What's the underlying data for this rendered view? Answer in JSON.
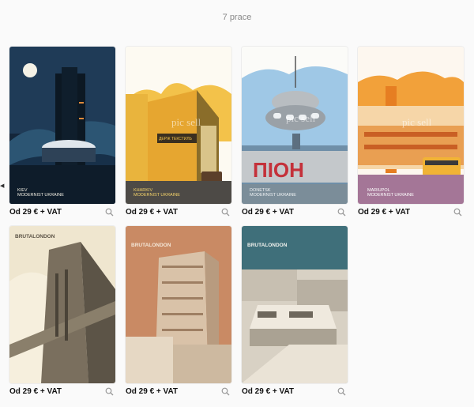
{
  "header": {
    "count_label": "7 prace"
  },
  "icons": {
    "left_arrow": "chevron-left-icon",
    "zoom": "magnifier-icon"
  },
  "colors": {
    "kiev": "#1f3b57",
    "kharkiv": "#e8b43a",
    "donetsk": "#8fbfe0",
    "mariupol": "#f2a13a",
    "bruta_sand": "#d9cfb8",
    "bruta_rust": "#c07c56",
    "bruta_teal": "#3f6f7a"
  },
  "items": [
    {
      "price": "Od 29 € + VAT",
      "caption": [
        "KIEV",
        "MODERNIST UKRAINE"
      ]
    },
    {
      "price": "Od 29 € + VAT",
      "caption": [
        "KHARKIV",
        "MODERNIST UKRAINE"
      ],
      "sign": "ДЕРЖ ТЕКСТИЛЬ"
    },
    {
      "price": "Od 29 € + VAT",
      "caption": [
        "DONETSK",
        "MODERNIST UKRAINE"
      ],
      "sign": "ПІОН"
    },
    {
      "price": "Od 29 € + VAT",
      "caption": [
        "MARIUPOL",
        "MODERNIST UKRAINE"
      ]
    },
    {
      "price": "Od 29 € + VAT",
      "brand": "BRUTALONDON"
    },
    {
      "price": "Od 29 € + VAT",
      "brand": "BRUTALONDON"
    },
    {
      "price": "Od 29 € + VAT",
      "brand": "BRUTALONDON"
    }
  ],
  "watermark": "pic sell"
}
